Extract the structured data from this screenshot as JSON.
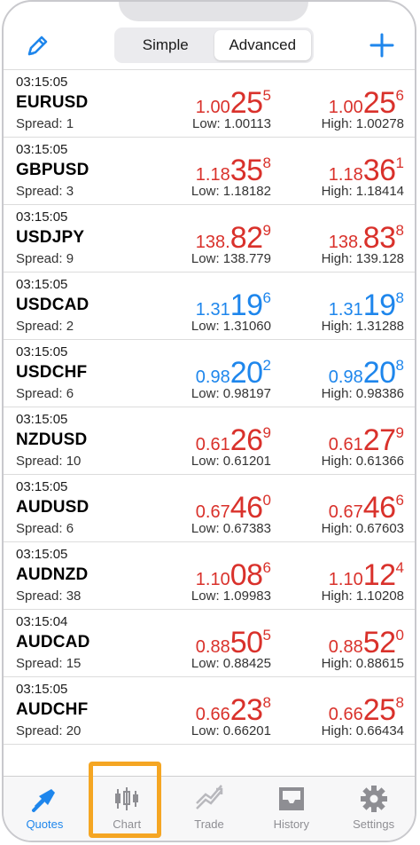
{
  "header": {
    "segments": [
      {
        "label": "Simple",
        "active": false
      },
      {
        "label": "Advanced",
        "active": true
      }
    ]
  },
  "colors": {
    "down": "#d9312b",
    "up": "#1e86ec",
    "accent": "#1e86ec",
    "highlight": "#f5a623"
  },
  "quotes": [
    {
      "time": "03:15:05",
      "symbol": "EURUSD",
      "spread": "Spread: 1",
      "dir": "down",
      "bid": {
        "pre": "1.00",
        "big": "25",
        "sup": "5"
      },
      "ask": {
        "pre": "1.00",
        "big": "25",
        "sup": "6"
      },
      "low": "Low: 1.00113",
      "high": "High: 1.00278"
    },
    {
      "time": "03:15:05",
      "symbol": "GBPUSD",
      "spread": "Spread: 3",
      "dir": "down",
      "bid": {
        "pre": "1.18",
        "big": "35",
        "sup": "8"
      },
      "ask": {
        "pre": "1.18",
        "big": "36",
        "sup": "1"
      },
      "low": "Low: 1.18182",
      "high": "High: 1.18414"
    },
    {
      "time": "03:15:05",
      "symbol": "USDJPY",
      "spread": "Spread: 9",
      "dir": "down",
      "bid": {
        "pre": "138.",
        "big": "82",
        "sup": "9"
      },
      "ask": {
        "pre": "138.",
        "big": "83",
        "sup": "8"
      },
      "low": "Low: 138.779",
      "high": "High: 139.128"
    },
    {
      "time": "03:15:05",
      "symbol": "USDCAD",
      "spread": "Spread: 2",
      "dir": "up",
      "bid": {
        "pre": "1.31",
        "big": "19",
        "sup": "6"
      },
      "ask": {
        "pre": "1.31",
        "big": "19",
        "sup": "8"
      },
      "low": "Low: 1.31060",
      "high": "High: 1.31288"
    },
    {
      "time": "03:15:05",
      "symbol": "USDCHF",
      "spread": "Spread: 6",
      "dir": "up",
      "bid": {
        "pre": "0.98",
        "big": "20",
        "sup": "2"
      },
      "ask": {
        "pre": "0.98",
        "big": "20",
        "sup": "8"
      },
      "low": "Low: 0.98197",
      "high": "High: 0.98386"
    },
    {
      "time": "03:15:05",
      "symbol": "NZDUSD",
      "spread": "Spread: 10",
      "dir": "down",
      "bid": {
        "pre": "0.61",
        "big": "26",
        "sup": "9"
      },
      "ask": {
        "pre": "0.61",
        "big": "27",
        "sup": "9"
      },
      "low": "Low: 0.61201",
      "high": "High: 0.61366"
    },
    {
      "time": "03:15:05",
      "symbol": "AUDUSD",
      "spread": "Spread: 6",
      "dir": "down",
      "bid": {
        "pre": "0.67",
        "big": "46",
        "sup": "0"
      },
      "ask": {
        "pre": "0.67",
        "big": "46",
        "sup": "6"
      },
      "low": "Low: 0.67383",
      "high": "High: 0.67603"
    },
    {
      "time": "03:15:05",
      "symbol": "AUDNZD",
      "spread": "Spread: 38",
      "dir": "down",
      "bid": {
        "pre": "1.10",
        "big": "08",
        "sup": "6"
      },
      "ask": {
        "pre": "1.10",
        "big": "12",
        "sup": "4"
      },
      "low": "Low: 1.09983",
      "high": "High: 1.10208"
    },
    {
      "time": "03:15:04",
      "symbol": "AUDCAD",
      "spread": "Spread: 15",
      "dir": "down",
      "bid": {
        "pre": "0.88",
        "big": "50",
        "sup": "5"
      },
      "ask": {
        "pre": "0.88",
        "big": "52",
        "sup": "0"
      },
      "low": "Low: 0.88425",
      "high": "High: 0.88615"
    },
    {
      "time": "03:15:05",
      "symbol": "AUDCHF",
      "spread": "Spread: 20",
      "dir": "down",
      "bid": {
        "pre": "0.66",
        "big": "23",
        "sup": "8"
      },
      "ask": {
        "pre": "0.66",
        "big": "25",
        "sup": "8"
      },
      "low": "Low: 0.66201",
      "high": "High: 0.66434"
    }
  ],
  "tabs": [
    {
      "label": "Quotes",
      "icon": "quotes-icon",
      "active": true
    },
    {
      "label": "Chart",
      "icon": "candlestick-chart-icon",
      "active": false
    },
    {
      "label": "Trade",
      "icon": "trade-icon",
      "active": false
    },
    {
      "label": "History",
      "icon": "inbox-history-icon",
      "active": false
    },
    {
      "label": "Settings",
      "icon": "gear-icon",
      "active": false
    }
  ]
}
